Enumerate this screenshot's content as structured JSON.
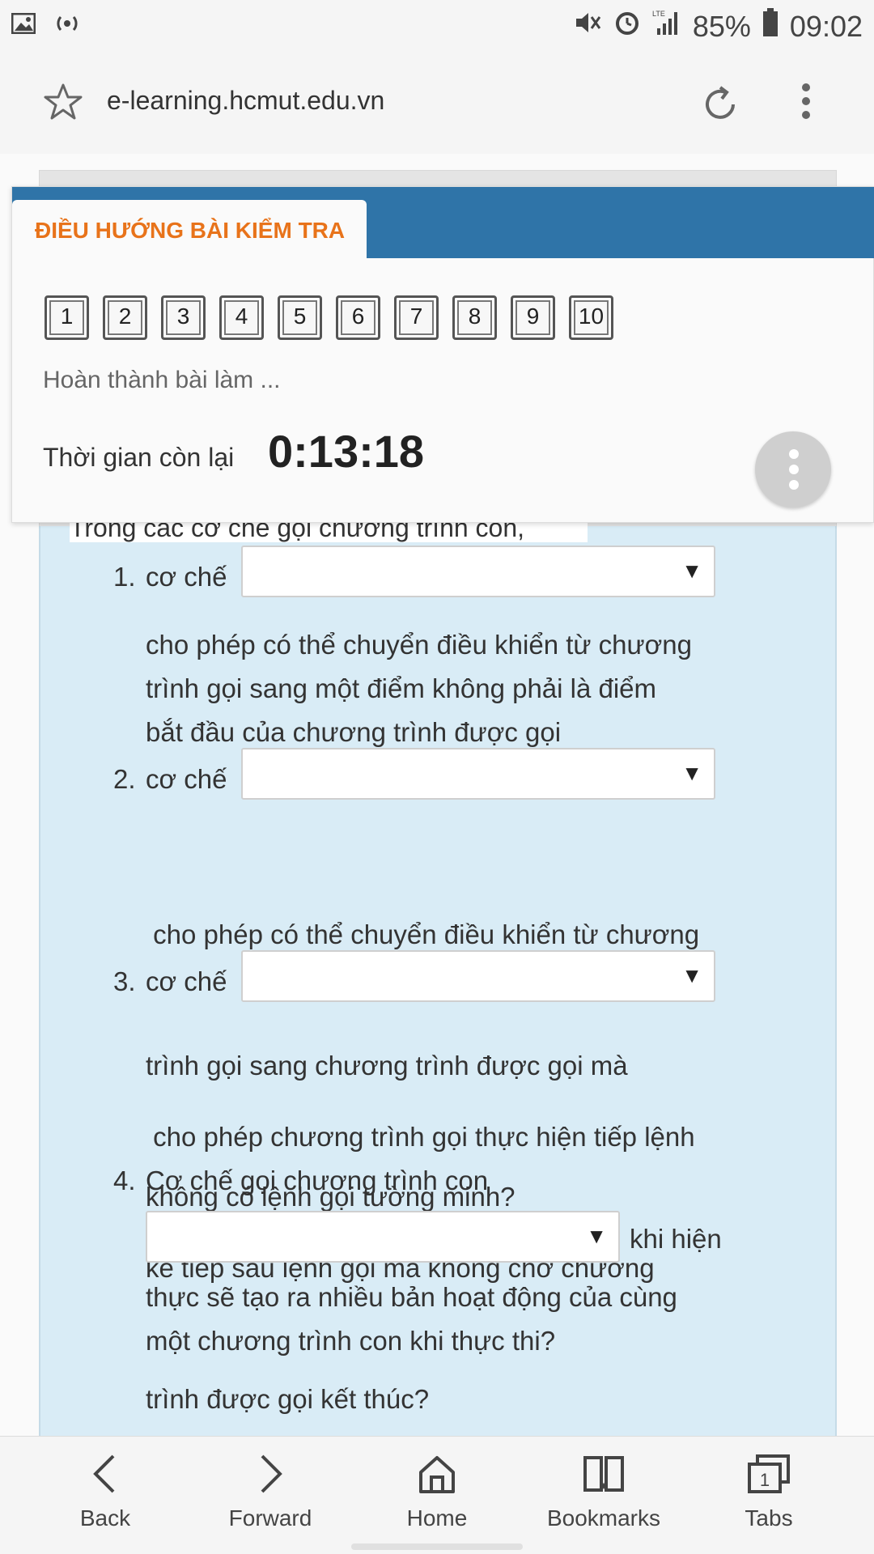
{
  "status_bar": {
    "battery": "85%",
    "time": "09:02",
    "network": "LTE"
  },
  "browser": {
    "url": "e-learning.hcmut.edu.vn"
  },
  "quiz_nav": {
    "title": "ĐIỀU HƯỚNG BÀI KIỂM TRA",
    "buttons": [
      "1",
      "2",
      "3",
      "4",
      "5",
      "6",
      "7",
      "8",
      "9",
      "10"
    ],
    "finish_label": "Hoàn thành bài làm ...",
    "timer_label": "Thời gian còn lại",
    "timer_value": "0:13:18"
  },
  "question": {
    "intro_cut": "Trong các cơ chế gọi chương trình con,",
    "items": [
      {
        "num": "1.",
        "prefix": "cơ chế",
        "text_lines": [
          "cho phép có thể chuyển điều khiển từ chương",
          "trình gọi sang một điểm không phải là điểm",
          "bắt đầu của chương trình được gọi"
        ]
      },
      {
        "num": "2.",
        "prefix": "cơ chế",
        "text_lines": [
          " cho phép có thể chuyển điều khiển từ chương",
          "trình gọi sang chương trình được gọi mà",
          "không có lệnh gọi tường minh?"
        ]
      },
      {
        "num": "3.",
        "prefix": "cơ chế",
        "text_lines": [
          " cho phép chương trình gọi thực hiện tiếp lệnh",
          "kế tiếp sau lệnh gọi mà không chờ chương",
          "trình được gọi kết thúc?"
        ]
      },
      {
        "num": "4.",
        "prefix": "Cơ chế gọi chương trình con",
        "suffix": "khi hiện",
        "text_lines": [
          "thực sẽ tạo ra nhiều bản hoạt động của cùng",
          "một chương trình con khi thực thi?"
        ]
      }
    ],
    "dropdown_arrow": "▼"
  },
  "bottom_nav": {
    "back": "Back",
    "forward": "Forward",
    "home": "Home",
    "bookmarks": "Bookmarks",
    "tabs": "Tabs",
    "tab_count": "1"
  },
  "colors": {
    "nav_header": "#2f74a8",
    "nav_title": "#e8731a",
    "question_bg": "#d9ecf6"
  }
}
